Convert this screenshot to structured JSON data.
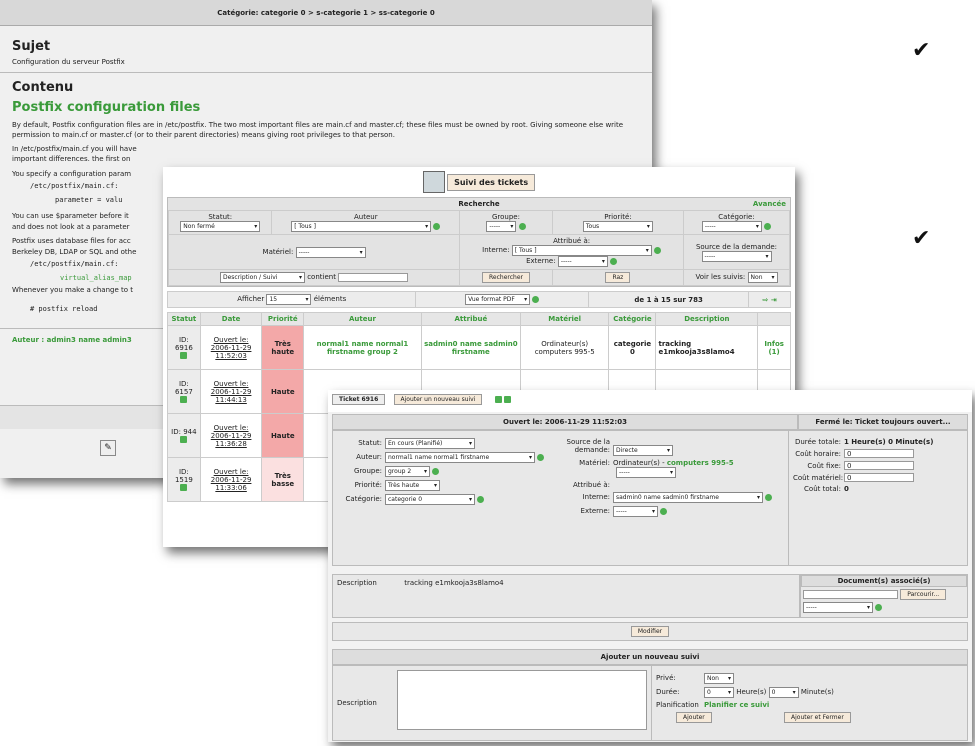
{
  "checks": [
    "✔",
    "✔"
  ],
  "w1": {
    "breadcrumb": "Catégorie: categorie 0 > s-categorie 1 > ss-categorie 0",
    "subject_title": "Sujet",
    "subject": "Configuration du serveur Postfix",
    "content_title": "Contenu",
    "article_title": "Postfix configuration files",
    "p1": "By default, Postfix configuration files are in /etc/postfix. The two most important files are main.cf and master.cf; these files must be owned by root. Giving someone else write permission to main.cf or master.cf (or to their parent directories) means giving root privileges to that person.",
    "p2": "In /etc/postfix/main.cf you will have",
    "p2b": "important differences. the first on",
    "p3": "You specify a configuration param",
    "code1": "/etc/postfix/main.cf:",
    "code2": "parameter = valu",
    "p4": "You can use $parameter before it",
    "p4b": "and does not look at a parameter",
    "p5": "Postfix uses database files for acc",
    "p5b": "Berkeley DB, LDAP or SQL and othe",
    "code3": "/etc/postfix/main.cf:",
    "code4": "virtual_alias_map",
    "p6": "Whenever you make a change to t",
    "code5": "# postfix reload",
    "author": "Auteur : admin3 name admin3"
  },
  "w2": {
    "title": "Suivi des tickets",
    "search": "Recherche",
    "advanced": "Avancée",
    "statut_l": "Statut:",
    "statut_v": "Non fermé",
    "auteur_l": "Auteur",
    "auteur_v": "[ Tous ]",
    "groupe_l": "Groupe:",
    "groupe_v": "-----",
    "prio_l": "Priorité:",
    "prio_v": "Tous",
    "cat_l": "Catégorie:",
    "cat_v": "-----",
    "mat_l": "Matériel:",
    "mat_v": "-----",
    "attr_l": "Attribué à:",
    "interne_l": "Interne:",
    "interne_v": "[ Tous ]",
    "externe_l": "Externe:",
    "externe_v": "-----",
    "source_l": "Source de la demande:",
    "source_v": "-----",
    "desc_sel": "Description / Suivi",
    "contient": "contient",
    "rechercher": "Rechercher",
    "raz": "Raz",
    "voir_l": "Voir les suivis:",
    "voir_v": "Non",
    "afficher": "Afficher",
    "afficher_v": "15",
    "elements": "éléments",
    "vue": "Vue format PDF",
    "count": "de 1 à 15 sur 783",
    "cols": [
      "Statut",
      "Date",
      "Priorité",
      "Auteur",
      "Attribué",
      "Matériel",
      "Catégorie",
      "Description",
      ""
    ],
    "rows": [
      {
        "id": "ID: 6916",
        "date1": "Ouvert le:",
        "date2": "2006-11-29 11:52:03",
        "prio": "Très haute",
        "auteur": "normal1 name normal1 firstname group 2",
        "attr": "sadmin0 name sadmin0 firstname",
        "mat": "Ordinateur(s) computers 995-5",
        "cat": "categorie 0",
        "desc": "tracking e1mkooja3s8lamo4",
        "infos": "Infos (1)"
      },
      {
        "id": "ID: 6157",
        "date1": "Ouvert le:",
        "date2": "2006-11-29 11:44:13",
        "prio": "Haute",
        "auteur": "",
        "attr": "",
        "mat": "",
        "cat": "",
        "desc": "",
        "infos": ""
      },
      {
        "id": "ID: 944",
        "date1": "Ouvert le:",
        "date2": "2006-11-29 11:36:28",
        "prio": "Haute",
        "auteur": "",
        "attr": "",
        "mat": "",
        "cat": "",
        "desc": "",
        "infos": ""
      },
      {
        "id": "ID: 1519",
        "date1": "Ouvert le:",
        "date2": "2006-11-29 11:33:06",
        "prio": "Très basse",
        "auteur": "",
        "attr": "",
        "mat": "",
        "cat": "",
        "desc": "",
        "infos": ""
      }
    ]
  },
  "w3": {
    "tab": "Ticket 6916",
    "add_tab": "Ajouter un nouveau suivi",
    "opened": "Ouvert le: 2006-11-29 11:52:03",
    "closed": "Fermé le: Ticket toujours ouvert...",
    "statut_l": "Statut:",
    "statut_v": "En cours (Planifié)",
    "auteur_l": "Auteur:",
    "auteur_v": "normal1 name normal1 firstname",
    "groupe_l": "Groupe:",
    "groupe_v": "group 2",
    "prio_l": "Priorité:",
    "prio_v": "Très haute",
    "cat_l": "Catégorie:",
    "cat_v": "categorie 0",
    "source_l": "Source de la demande:",
    "source_v": "Directe",
    "mat_l": "Matériel:",
    "mat_v": "Ordinateur(s) -",
    "mat_link": "computers 995-5",
    "mat_sel": "-----",
    "attr_l": "Attribué à:",
    "interne_l": "Interne:",
    "interne_v": "sadmin0 name sadmin0 firstname",
    "externe_l": "Externe:",
    "externe_v": "-----",
    "duree_l": "Durée totale:",
    "duree_v": "1 Heure(s) 0 Minute(s)",
    "ch_l": "Coût horaire:",
    "ch_v": "0",
    "cf_l": "Coût fixe:",
    "cf_v": "0",
    "cm_l": "Coût matériel:",
    "cm_v": "0",
    "ct_l": "Coût total:",
    "ct_v": "0",
    "desc_l": "Description",
    "desc_v": "tracking e1mkooja3s8lamo4",
    "docs": "Document(s) associé(s)",
    "parcourir": "Parcourir...",
    "doc_sel": "-----",
    "modifier": "Modifier",
    "add_title": "Ajouter un nouveau suivi",
    "desc2_l": "Description",
    "prive_l": "Privé:",
    "prive_v": "Non",
    "duree2_l": "Durée:",
    "h_v": "0",
    "h_l": "Heure(s)",
    "m_v": "0",
    "m_l": "Minute(s)",
    "plan_l": "Planification",
    "plan_link": "Planifier ce suivi",
    "ajouter": "Ajouter",
    "ajouter_fermer": "Ajouter et Fermer"
  }
}
